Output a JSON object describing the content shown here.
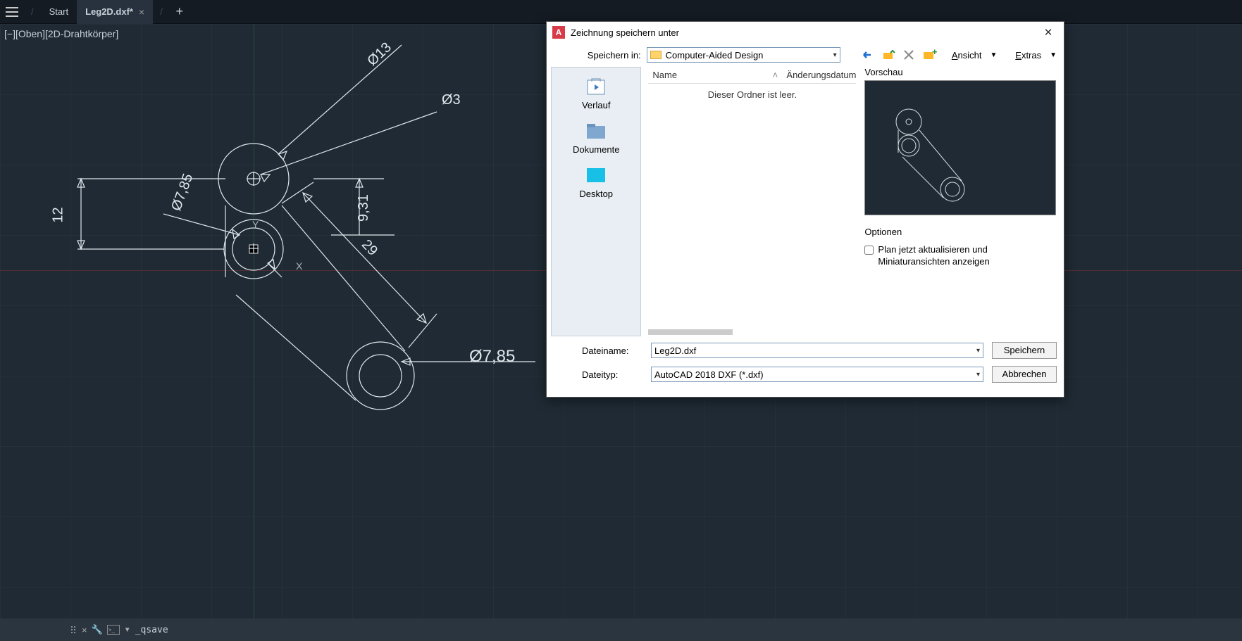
{
  "tabs": {
    "start": "Start",
    "active": "Leg2D.dxf*"
  },
  "view_label": "[−][Oben][2D-Drahtkörper]",
  "axis": {
    "x": "X",
    "y": "Y"
  },
  "dims": {
    "d13": "Ø13",
    "d3": "Ø3",
    "d785a": "Ø7,85",
    "d785b": "Ø7,85",
    "l12": "12",
    "l931": "9,31",
    "l29": "29"
  },
  "dialog": {
    "title": "Zeichnung speichern unter",
    "save_in_label": "Speichern in:",
    "folder": "Computer-Aided Design",
    "view_menu": "Ansicht",
    "extras_menu": "Extras",
    "places": {
      "history": "Verlauf",
      "documents": "Dokumente",
      "desktop": "Desktop"
    },
    "col_name": "Name",
    "col_date": "Änderungsdatum",
    "empty": "Dieser Ordner ist leer.",
    "preview": "Vorschau",
    "options": "Optionen",
    "opt_update": "Plan jetzt aktualisieren und Miniaturansichten anzeigen",
    "filename_label": "Dateiname:",
    "filename": "Leg2D.dxf",
    "filetype_label": "Dateityp:",
    "filetype": "AutoCAD 2018 DXF (*.dxf)",
    "save_btn": "Speichern",
    "cancel_btn": "Abbrechen"
  },
  "status": {
    "cmd": "_qsave"
  }
}
